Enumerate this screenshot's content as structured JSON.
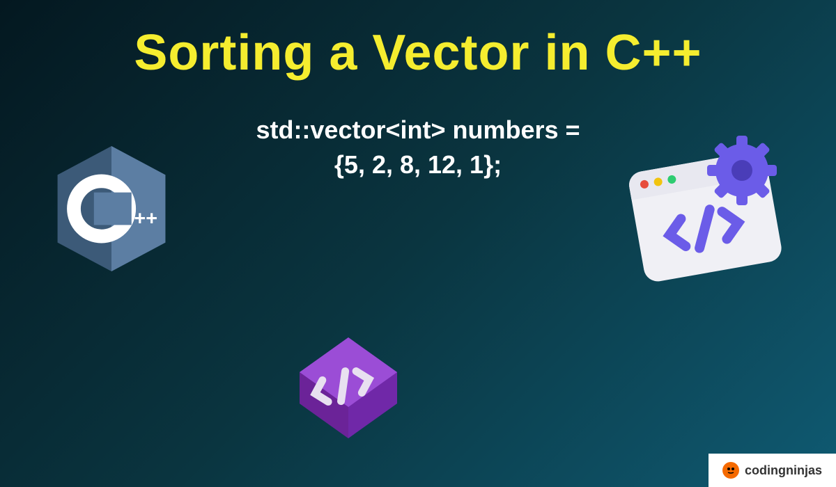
{
  "title": "Sorting a Vector in C++",
  "code": {
    "line1": "std::vector<int> numbers =",
    "line2": "{5, 2, 8, 12, 1};"
  },
  "brand": {
    "name": "codingninjas"
  },
  "colors": {
    "title": "#f5ed2f",
    "background_start": "#041820",
    "background_end": "#0f5a72",
    "cpp_blue": "#5c7ea3",
    "purple": "#8b3fb8",
    "browser_purple": "#6b5ce8"
  }
}
